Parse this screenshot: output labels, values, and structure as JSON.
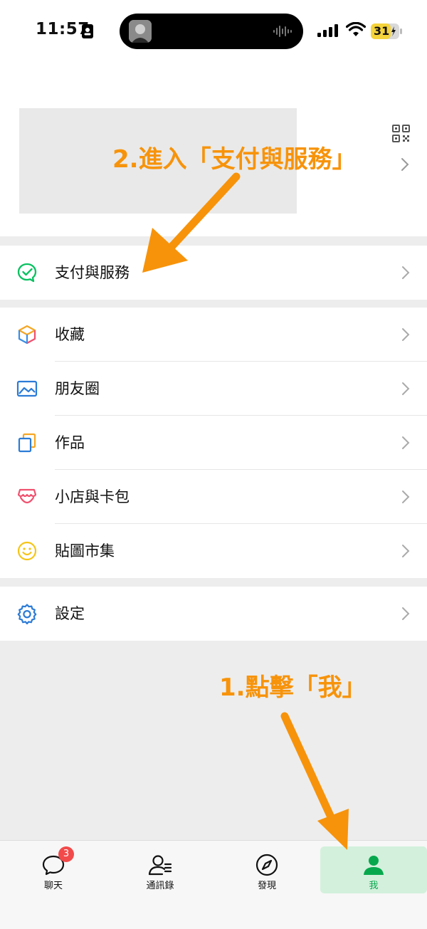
{
  "status_bar": {
    "time": "11:57",
    "battery": "31"
  },
  "menu": {
    "pay_label": "支付與服務",
    "items": [
      {
        "label": "收藏"
      },
      {
        "label": "朋友圈"
      },
      {
        "label": "作品"
      },
      {
        "label": "小店與卡包"
      },
      {
        "label": "貼圖市集"
      }
    ],
    "settings_label": "設定"
  },
  "tabs": [
    {
      "label": "聊天",
      "badge": "3"
    },
    {
      "label": "通訊錄"
    },
    {
      "label": "發現"
    },
    {
      "label": "我"
    }
  ],
  "annotations": {
    "step1": "1.點擊「我」",
    "step2": "2.進入「支付與服務」"
  },
  "colors": {
    "accent": "#07c160",
    "annotation": "#f7930a",
    "badge": "#f24a4a"
  }
}
